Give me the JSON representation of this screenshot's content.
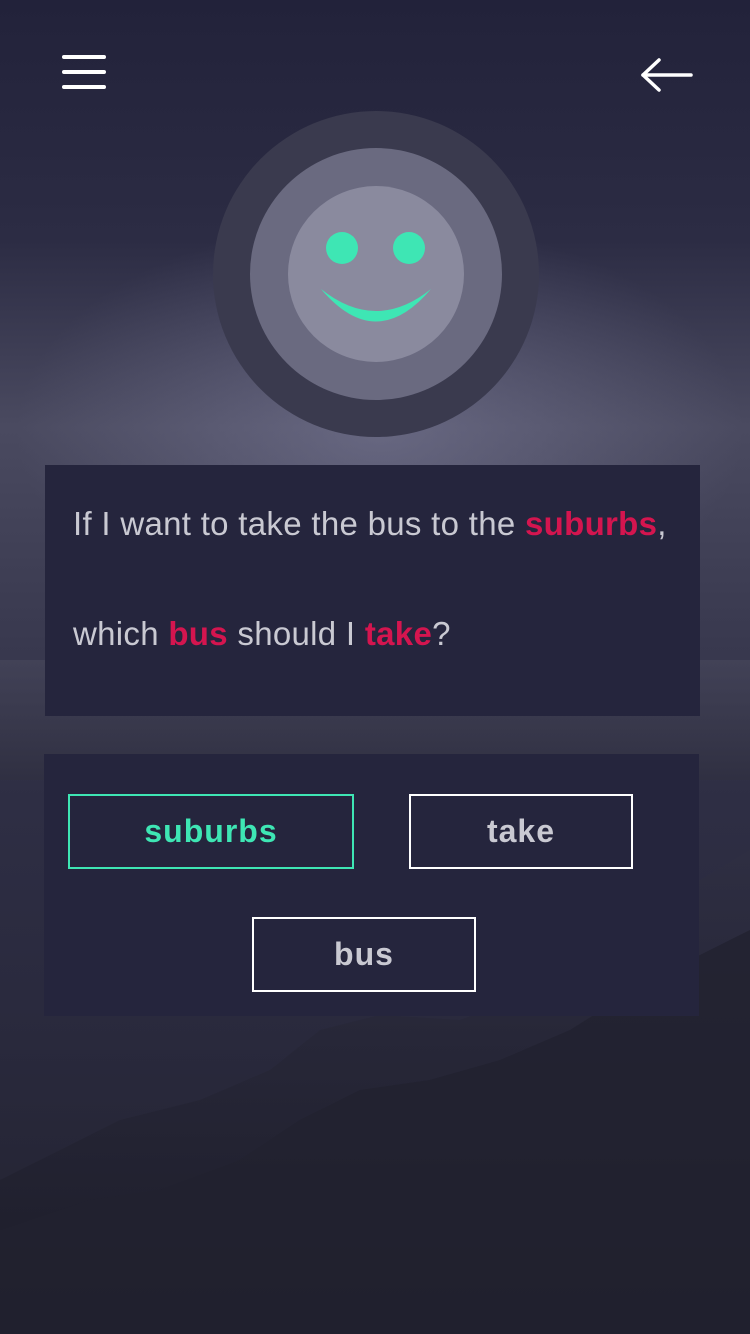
{
  "colors": {
    "background": "#23233a",
    "card": "#25253d",
    "accent_green": "#3ee6b4",
    "accent_red": "#d4154f",
    "text": "#c9c9d2",
    "avatar_outer": "#3a3a4e",
    "avatar_middle": "#6a6a80",
    "avatar_inner": "#8a8a9e"
  },
  "header": {
    "menu_icon": "hamburger-menu-icon",
    "back_icon": "arrow-left-icon"
  },
  "avatar": {
    "icon": "smiley-face-icon"
  },
  "question": {
    "line1": {
      "before": "If I want to take the bus to the ",
      "keyword": "suburbs",
      "after": ","
    },
    "line2": {
      "part1": "which ",
      "keyword1": "bus",
      "part2": " should I ",
      "keyword2": "take",
      "part3": "?"
    }
  },
  "answers": [
    {
      "label": "suburbs",
      "selected": true
    },
    {
      "label": "take",
      "selected": false
    },
    {
      "label": "bus",
      "selected": false
    }
  ]
}
